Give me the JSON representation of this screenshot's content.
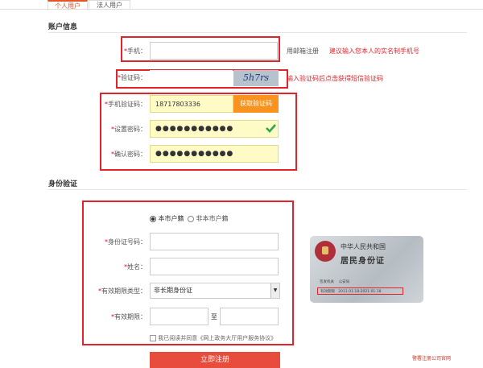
{
  "tabs": [
    {
      "label": "个人用户",
      "active": true
    },
    {
      "label": "法人用户",
      "active": false
    }
  ],
  "account": {
    "section_title": "账户信息",
    "phone_label": "手机：",
    "phone_value": "",
    "email_register_link": "用邮箱注册",
    "phone_hint": "建议输入您本人的实名制手机号",
    "captcha_label": "验证码：",
    "captcha_value": "",
    "captcha_text": "5h7rs",
    "captcha_hint": "输入验证码后点击获得短信验证码",
    "sms_label": "手机验证码：",
    "sms_value": "18717803336",
    "sms_button": "获取验证码",
    "password_label": "设置密码：",
    "password_value": "●●●●●●●●●●●",
    "confirm_label": "确认密码：",
    "confirm_value": "●●●●●●●●●●●"
  },
  "identity": {
    "section_title": "身份验证",
    "residence_options": [
      "本市户籍",
      "非本市户籍"
    ],
    "residence_selected": "本市户籍",
    "id_label": "身份证号码：",
    "id_value": "",
    "name_label": "姓名：",
    "name_value": "",
    "validity_type_label": "有效期限类型：",
    "validity_type_value": "非长期身份证",
    "validity_label": "有效期限：",
    "validity_to": "至",
    "agree_text": "我已阅读并同意《网上政务大厅用户服务协议》",
    "agree_checked": false
  },
  "id_card": {
    "line1": "中华人民共和国",
    "line2": "居民身份证",
    "issuer_label": "签发机关",
    "issuer_value": "公安局",
    "validity_label": "有效期限",
    "validity_value": "2011.01.18-2021.01.18"
  },
  "submit_label": "立即注册",
  "watermark": "警署注册公司官网",
  "colors": {
    "accent": "#e5532b",
    "red": "#e0242a",
    "orange": "#f7931e",
    "submit": "#e84c3d"
  }
}
